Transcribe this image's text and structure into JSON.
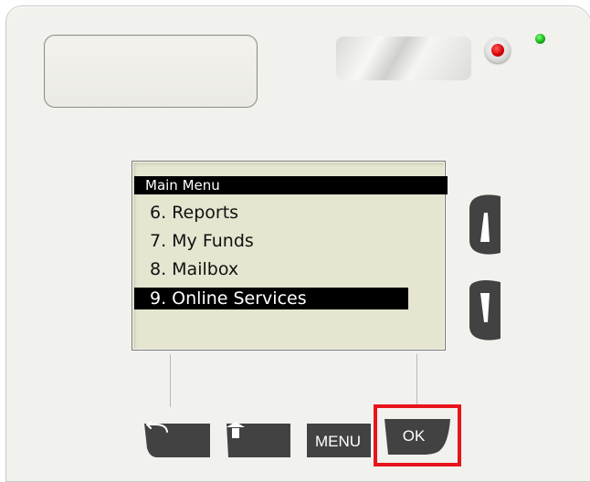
{
  "screen": {
    "title": "Main Menu",
    "items": [
      {
        "label": "6. Reports",
        "selected": false
      },
      {
        "label": "7. My Funds",
        "selected": false
      },
      {
        "label": "8. Mailbox",
        "selected": false
      },
      {
        "label": "9. Online Services",
        "selected": true
      }
    ]
  },
  "nav": {
    "up_icon": "arrow-up-icon",
    "down_icon": "arrow-down-icon"
  },
  "soft_keys": {
    "back_icon": "back-arrow-icon",
    "home_icon": "home-icon",
    "menu_label": "MENU",
    "ok_label": "OK"
  },
  "colors": {
    "lcd_background": "#e6e5d0",
    "key_color": "#424242",
    "highlight": "#e8141b",
    "power_led": "#d40000",
    "status_led": "#16b516"
  }
}
